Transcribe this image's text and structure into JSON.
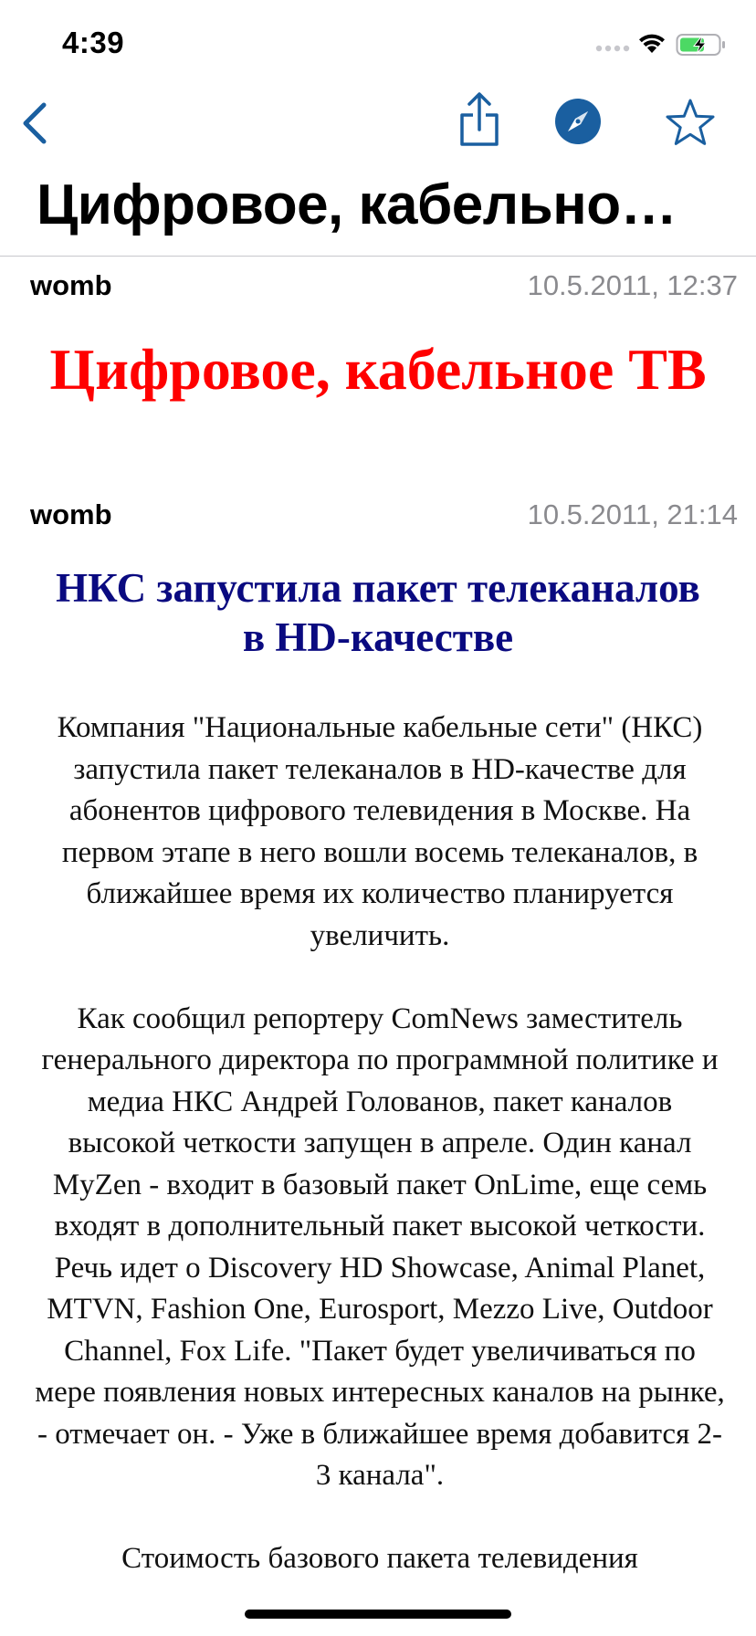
{
  "status_bar": {
    "time": "4:39",
    "signal_icon": "signal-dots-icon",
    "wifi_icon": "wifi-icon",
    "battery_icon": "battery-charging-icon",
    "battery_color": "#4cd964"
  },
  "nav": {
    "back_icon": "chevron-left-icon",
    "share_icon": "share-icon",
    "safari_icon": "compass-icon",
    "favorite_icon": "star-icon",
    "accent_color": "#1a5fa0"
  },
  "page_title": "Цифровое, кабельно…",
  "posts": [
    {
      "author": "womb",
      "date": "10.5.2011, 12:37",
      "headline": "Цифровое, кабельное ТВ",
      "headline_color": "#ff0000"
    },
    {
      "author": "womb",
      "date": "10.5.2011, 21:14",
      "headline": "НКС запустила пакет телеканалов в HD-качестве",
      "headline_color": "#0a0a80",
      "paragraphs": [
        "Компания \"Национальные кабельные сети\" (НКС) запустила пакет телеканалов в HD-качестве для абонентов цифрового телевидения в Москве. На первом этапе в него вошли восемь телеканалов, в ближайшее время их количество планируется увеличить.",
        "Как сообщил репортеру ComNews заместитель генерального директора по программной политике и медиа НКС Андрей Голованов, пакет каналов высокой четкости запущен в апреле. Один канал MyZen - входит в базовый пакет OnLime, еще семь входят в дополнительный пакет высокой четкости. Речь идет о Discovery HD Showcase, Animal Planet, MTVN, Fashion One, Eurosport, Mezzo Live, Outdoor Channel, Fox Life. \"Пакет будет увеличиваться по мере появления новых интересных каналов на рынке, - отмечает он. - Уже в ближайшее время добавится 2-3 канала\".",
        "Стоимость базового пакета телевидения"
      ]
    }
  ]
}
